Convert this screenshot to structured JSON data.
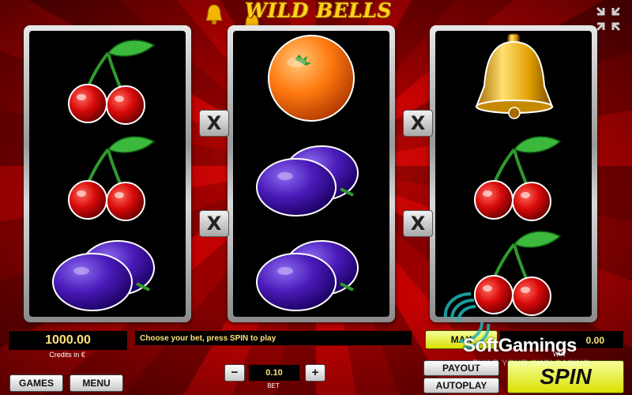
{
  "game": {
    "title": "WILD BELLS"
  },
  "reels": [
    {
      "symbols": [
        "cherry",
        "cherry",
        "plum"
      ]
    },
    {
      "symbols": [
        "orange",
        "plum",
        "plum"
      ]
    },
    {
      "symbols": [
        "bell",
        "cherry",
        "cherry"
      ]
    }
  ],
  "multipliers": [
    "X",
    "X",
    "X",
    "X"
  ],
  "status": {
    "credits": "1000.00",
    "credits_label": "Credits in €",
    "message": "Choose your bet, press SPIN to play",
    "win": "0.00",
    "win_label": "WIN"
  },
  "bet": {
    "value": "0.10",
    "label": "BET",
    "minus": "−",
    "plus": "+"
  },
  "buttons": {
    "games": "GAMES",
    "menu": "MENU",
    "max_bet": "MAX",
    "payout": "PAYOUT",
    "autoplay": "AUTOPLAY",
    "spin": "SPIN"
  },
  "watermark": {
    "brand": "SoftGamings",
    "tagline": "BUILD YOUR OWN CASINO"
  },
  "colors": {
    "accent_yellow": "#e8f000",
    "text_gold": "#ffe27a",
    "background_red": "#8f0000"
  }
}
